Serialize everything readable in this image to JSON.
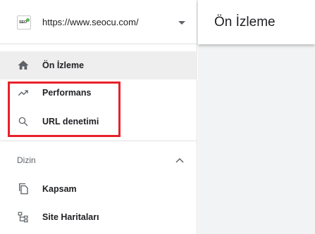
{
  "property": {
    "logo_text": "SEO",
    "url": "https://www.seocu.com/"
  },
  "nav": {
    "overview": "Ön İzleme",
    "performance": "Performans",
    "url_inspection": "URL denetimi"
  },
  "index_section": {
    "title": "Dizin",
    "coverage": "Kapsam",
    "sitemaps": "Site Haritaları"
  },
  "header": {
    "title": "Ön İzleme"
  },
  "colors": {
    "highlight": "#e8202a",
    "active_bg": "#eeeeee",
    "icon": "#5f6368"
  },
  "icons": [
    "home-icon",
    "trending-up-icon",
    "search-icon",
    "file-copy-icon",
    "sitemap-icon",
    "chevron-up-icon",
    "dropdown-caret-icon"
  ]
}
